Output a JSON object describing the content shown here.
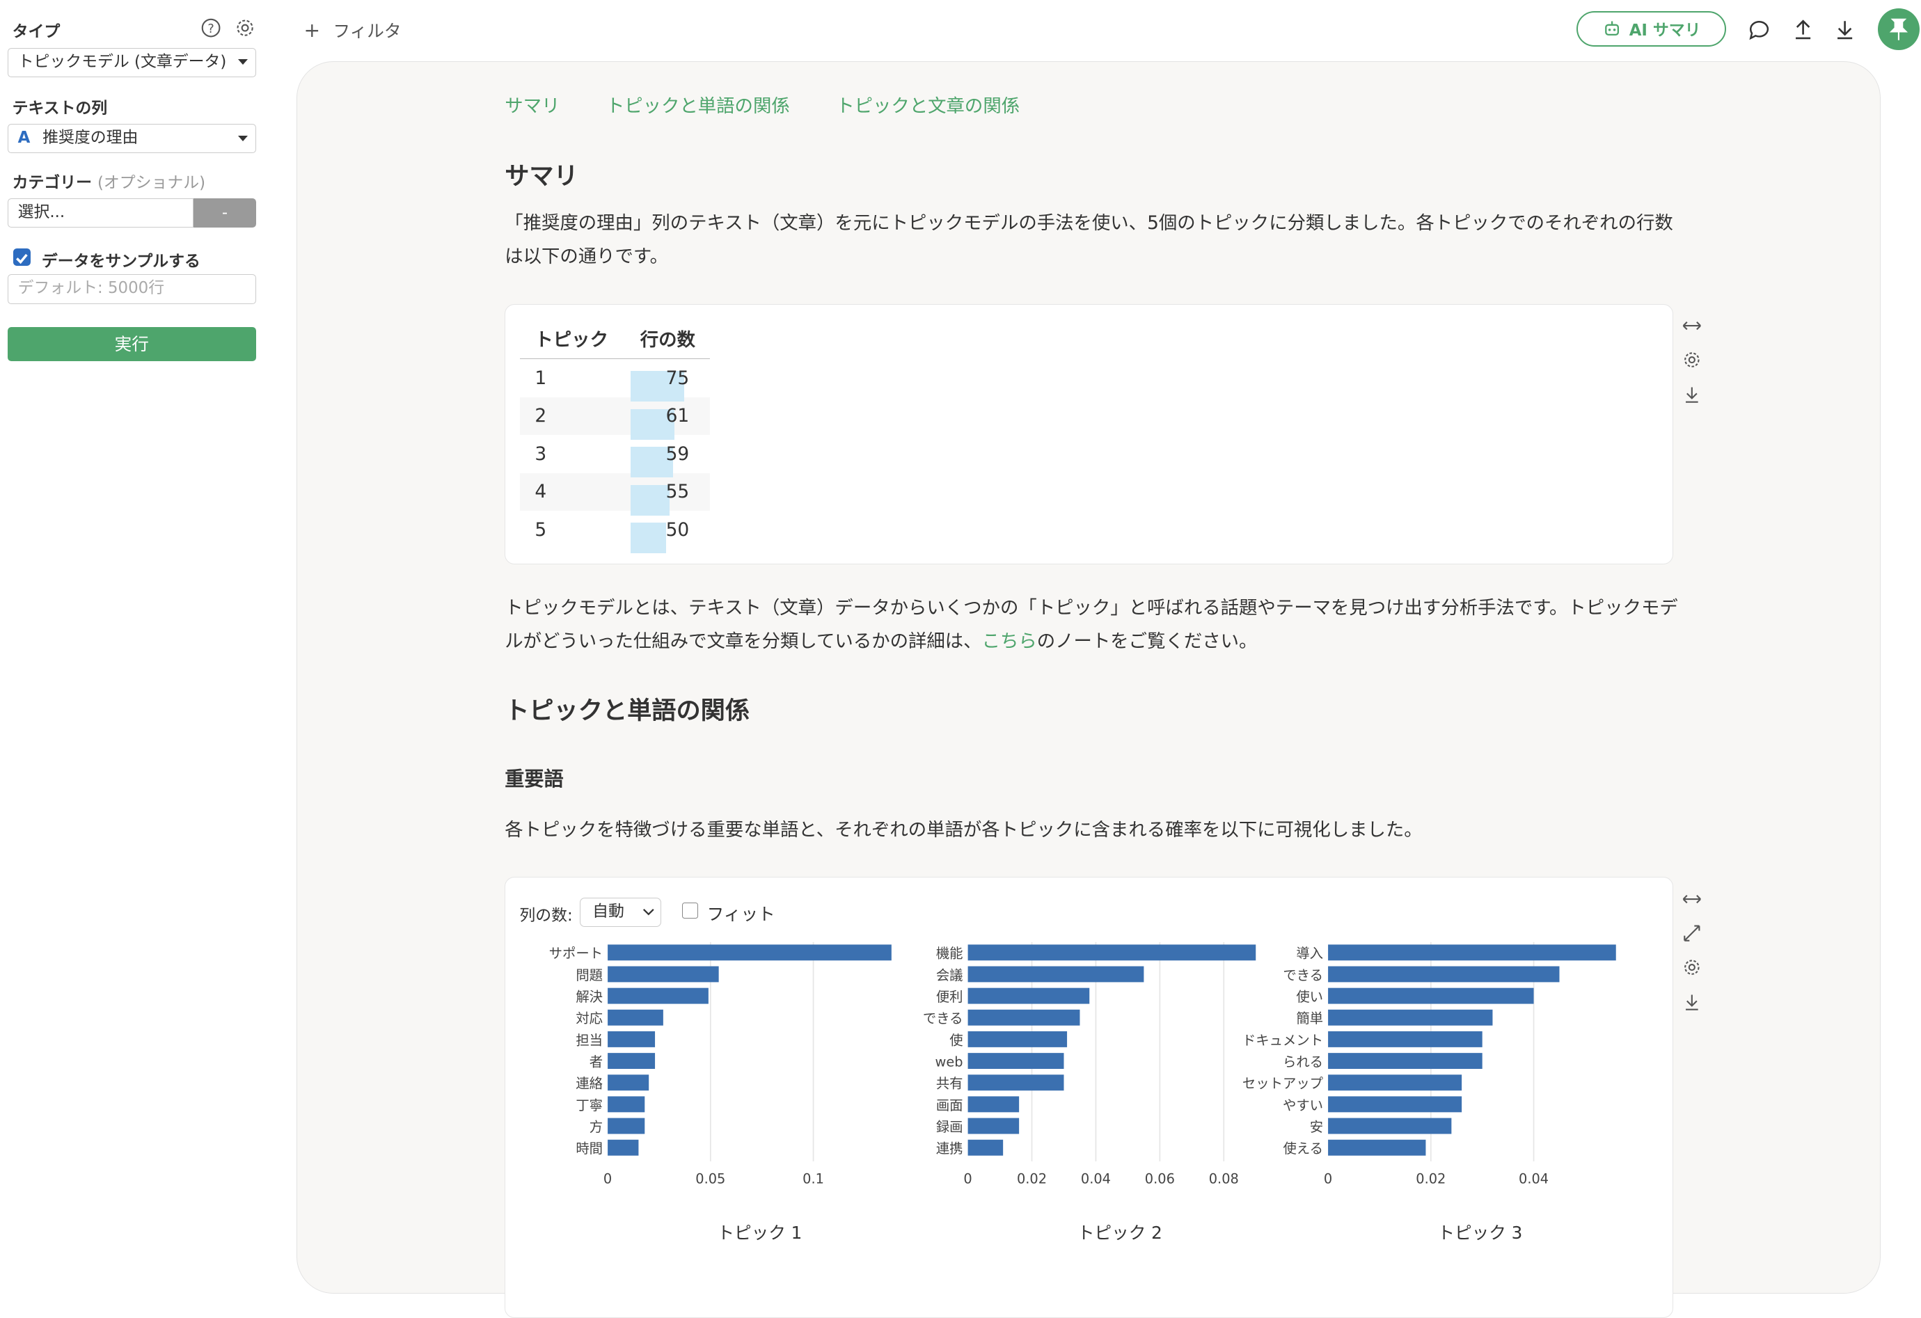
{
  "sidebar": {
    "type_label": "タイプ",
    "type_value": "トピックモデル (文章データ)",
    "text_col_label": "テキストの列",
    "text_col_value": "推奨度の理由",
    "text_col_type_glyph": "A",
    "category_label": "カテゴリー",
    "category_optional": "(オプショナル)",
    "category_placeholder": "選択...",
    "category_button": "-",
    "sample_label": "データをサンプルする",
    "sample_checked": true,
    "sample_placeholder": "デフォルト: 5000行",
    "run_label": "実行"
  },
  "topbar": {
    "filter_label": "フィルタ",
    "ai_label": "AI サマリ",
    "icons": [
      "comment-icon",
      "upload-icon",
      "download-icon",
      "pin-icon"
    ],
    "accent": "#4ea56c"
  },
  "tabs": [
    "サマリ",
    "トピックと単語の関係",
    "トピックと文章の関係"
  ],
  "summary": {
    "heading": "サマリ",
    "intro": "「推奨度の理由」列のテキスト（文章）を元にトピックモデルの手法を使い、5個のトピックに分類しました。各トピックでのそれぞれの行数は以下の通りです。",
    "table": {
      "headers": [
        "トピック",
        "行の数"
      ],
      "rows": [
        {
          "topic": "1",
          "count": 75
        },
        {
          "topic": "2",
          "count": 61
        },
        {
          "topic": "3",
          "count": 59
        },
        {
          "topic": "4",
          "count": 55
        },
        {
          "topic": "5",
          "count": 50
        }
      ],
      "bar_color": "#cde9f7"
    },
    "explain_1": "トピックモデルとは、テキスト（文章）データからいくつかの「トピック」と呼ばれる話題やテーマを見つけ出す分析手法です。トピックモデルがどういった仕組みで文章を分類しているかの詳細は、",
    "explain_link": "こちら",
    "explain_2": "のノートをご覧ください。"
  },
  "words": {
    "heading": "トピックと単語の関係",
    "subheading": "重要語",
    "description": "各トピックを特徴づける重要な単語と、それぞれの単語が各トピックに含まれる確率を以下に可視化しました。",
    "columns_label": "列の数:",
    "columns_value": "自動",
    "fit_label": "フィット"
  },
  "chart_data": [
    {
      "type": "bar",
      "orientation": "horizontal",
      "xlabel": "トピック 1",
      "categories": [
        "サポート",
        "問題",
        "解決",
        "対応",
        "担当",
        "者",
        "連絡",
        "丁寧",
        "方",
        "時間"
      ],
      "values": [
        0.138,
        0.054,
        0.049,
        0.027,
        0.023,
        0.023,
        0.02,
        0.018,
        0.018,
        0.015
      ],
      "xlim": [
        0,
        0.14
      ],
      "xticks": [
        "0",
        "0.05",
        "0.1"
      ],
      "xtick_values": [
        0,
        0.05,
        0.1
      ],
      "color": "#3b70b0"
    },
    {
      "type": "bar",
      "orientation": "horizontal",
      "xlabel": "トピック 2",
      "categories": [
        "機能",
        "会議",
        "便利",
        "できる",
        "使",
        "web",
        "共有",
        "画面",
        "録画",
        "連携"
      ],
      "values": [
        0.09,
        0.055,
        0.038,
        0.035,
        0.031,
        0.03,
        0.03,
        0.016,
        0.016,
        0.011
      ],
      "xlim": [
        0,
        0.09
      ],
      "xticks": [
        "0",
        "0.02",
        "0.04",
        "0.06",
        "0.08"
      ],
      "xtick_values": [
        0,
        0.02,
        0.04,
        0.06,
        0.08
      ],
      "color": "#3b70b0"
    },
    {
      "type": "bar",
      "orientation": "horizontal",
      "xlabel": "トピック 3",
      "categories": [
        "導入",
        "できる",
        "使い",
        "簡単",
        "ドキュメント",
        "られる",
        "セットアップ",
        "やすい",
        "安",
        "使える"
      ],
      "values": [
        0.056,
        0.045,
        0.04,
        0.032,
        0.03,
        0.03,
        0.026,
        0.026,
        0.024,
        0.019
      ],
      "xlim": [
        0,
        0.056
      ],
      "xticks": [
        "0",
        "0.02",
        "0.04"
      ],
      "xtick_values": [
        0,
        0.02,
        0.04
      ],
      "color": "#3b70b0"
    }
  ]
}
